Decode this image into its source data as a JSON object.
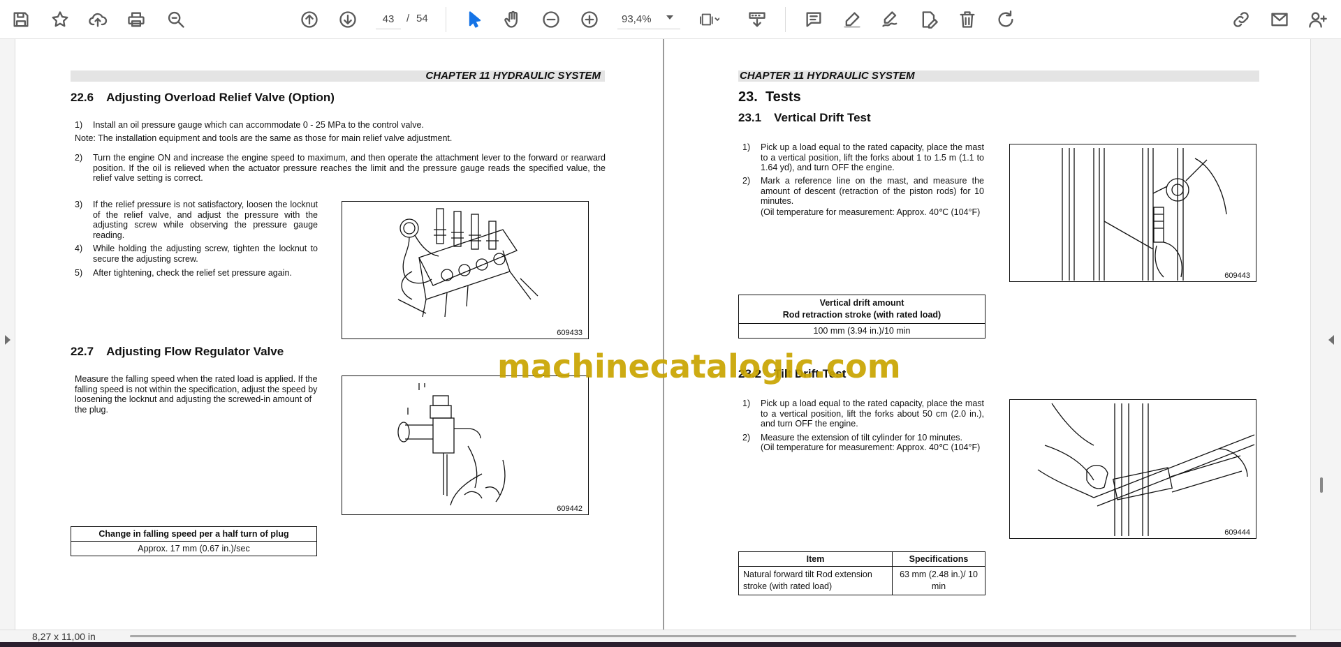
{
  "toolbar": {
    "page_current": "43",
    "page_separator": "/",
    "page_total": "54",
    "zoom": "93,4%",
    "icons": [
      "save-icon",
      "bookmark-star-icon",
      "cloud-upload-icon",
      "print-icon",
      "search-zoom-icon",
      "page-up-icon",
      "page-down-icon",
      "select-cursor-icon",
      "hand-tool-icon",
      "zoom-out-icon",
      "zoom-in-icon",
      "fit-page-icon",
      "scroll-mode-icon",
      "comment-icon",
      "highlight-pen-icon",
      "draw-sign-icon",
      "edit-text-icon",
      "delete-icon",
      "rotate-icon",
      "share-link-icon",
      "email-icon",
      "add-user-icon"
    ],
    "accent_color": "#1473e6"
  },
  "left_page": {
    "chapter": "CHAPTER 11 HYDRAULIC SYSTEM",
    "s226": {
      "number": "22.6",
      "title": "Adjusting Overload Relief Valve (Option)",
      "step1_n": "1)",
      "step1": "Install an oil pressure gauge which can accommodate 0 - 25 MPa to the control valve.",
      "note": "Note: The installation equipment and tools are the same as those for main relief valve adjustment.",
      "step2_n": "2)",
      "step2": "Turn the engine ON and increase the engine speed to maximum, and then operate the attachment lever to the forward or rearward position. If the oil is relieved when the actuator pressure reaches the limit and the pressure gauge reads the specified value, the relief valve setting is correct.",
      "step3_n": "3)",
      "step3": "If the relief pressure is not satisfactory, loosen the locknut of the relief valve, and adjust the pressure with the adjusting screw while observing the pressure gauge reading.",
      "step4_n": "4)",
      "step4": "While holding the adjusting screw, tighten the locknut to secure the adjusting screw.",
      "step5_n": "5)",
      "step5": "After tightening, check the relief set pressure again.",
      "fig_code": "609433"
    },
    "s227": {
      "number": "22.7",
      "title": "Adjusting Flow Regulator Valve",
      "text": "Measure the falling speed when the rated load is applied. If the falling speed is not within the specification, adjust the speed by loosening the locknut and adjusting the screwed-in amount of the plug.",
      "fig_code": "609442",
      "table_header": "Change in falling speed per a half turn of plug",
      "table_value": "Approx. 17 mm (0.67 in.)/sec"
    }
  },
  "right_page": {
    "chapter": "CHAPTER 11 HYDRAULIC SYSTEM",
    "s23": {
      "number": "23.",
      "title": "Tests"
    },
    "s231": {
      "number": "23.1",
      "title": "Vertical Drift Test",
      "step1_n": "1)",
      "step1": "Pick up a load equal to the rated capacity, place the mast to a vertical position, lift the forks about 1 to 1.5 m (1.1 to 1.64 yd), and turn OFF the engine.",
      "step2_n": "2)",
      "step2": "Mark a reference line on the mast, and measure the amount of descent (retraction of the piston rods) for 10 minutes.",
      "step2_note": "(Oil temperature for measurement: Approx. 40℃ (104°F)",
      "fig_code": "609443",
      "table_header_1": "Vertical drift amount",
      "table_header_2": "Rod retraction stroke (with rated load)",
      "table_value": "100 mm (3.94 in.)/10 min"
    },
    "s232": {
      "number": "23.2",
      "title": "Tilt Drift Test",
      "step1_n": "1)",
      "step1": "Pick up a load equal to the rated capacity, place the mast to a vertical position, lift the forks about 50 cm (2.0 in.), and turn OFF the engine.",
      "step2_n": "2)",
      "step2": "Measure the extension of tilt cylinder for 10 minutes.",
      "step2_note": "(Oil temperature for measurement: Approx. 40℃ (104°F)",
      "fig_code": "609444",
      "table_col1": "Item",
      "table_col2": "Specifications",
      "table_item": "Natural forward tilt Rod extension stroke (with rated load)",
      "table_spec": "63 mm (2.48 in.)/ 10 min"
    }
  },
  "watermark": "machinecatalogic.com",
  "status": {
    "page_size": "8,27 x 11,00 in"
  }
}
